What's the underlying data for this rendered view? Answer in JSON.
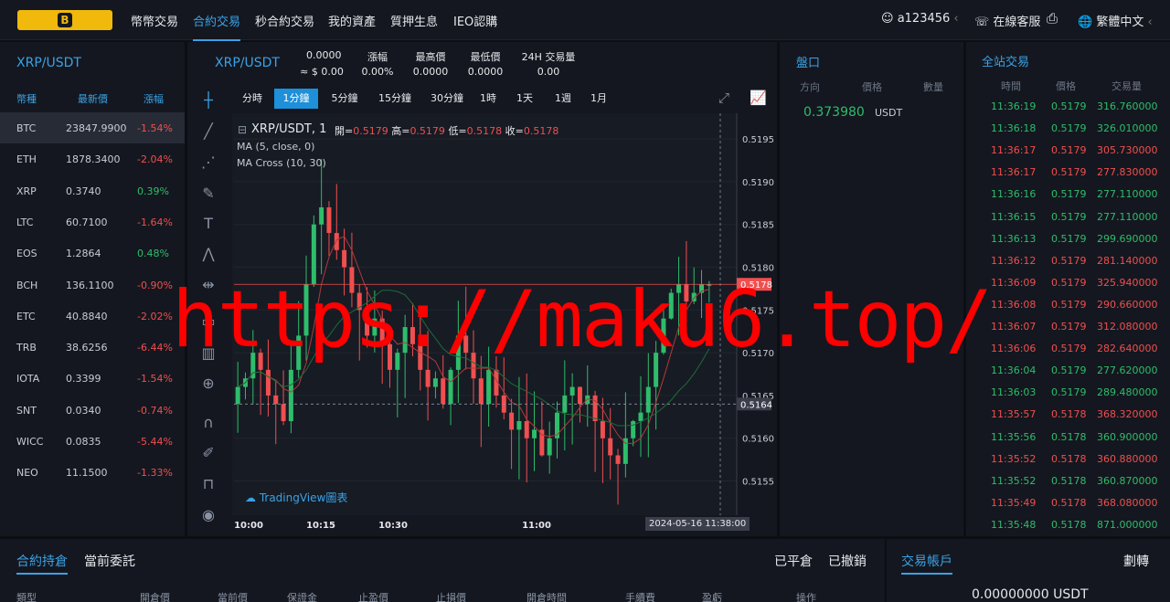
{
  "nav": {
    "logo_letter": "B",
    "links": [
      "幣幣交易",
      "合約交易",
      "秒合約交易",
      "我的資產",
      "質押生息",
      "IEO認購"
    ],
    "user": "a123456",
    "support": "在線客服",
    "lang": "繁體中文"
  },
  "market": {
    "title": "XRP/USDT",
    "headers": [
      "幣種",
      "最新價",
      "漲幅"
    ],
    "rows": [
      {
        "coin": "BTC",
        "price": "23847.9900",
        "change": "-1.54%",
        "up": false
      },
      {
        "coin": "ETH",
        "price": "1878.3400",
        "change": "-2.04%",
        "up": false
      },
      {
        "coin": "XRP",
        "price": "0.3740",
        "change": "0.39%",
        "up": true
      },
      {
        "coin": "LTC",
        "price": "60.7100",
        "change": "-1.64%",
        "up": false
      },
      {
        "coin": "EOS",
        "price": "1.2864",
        "change": "0.48%",
        "up": true
      },
      {
        "coin": "BCH",
        "price": "136.1100",
        "change": "-0.90%",
        "up": false
      },
      {
        "coin": "ETC",
        "price": "40.8840",
        "change": "-2.02%",
        "up": false
      },
      {
        "coin": "TRB",
        "price": "38.6256",
        "change": "-6.44%",
        "up": false
      },
      {
        "coin": "IOTA",
        "price": "0.3399",
        "change": "-1.54%",
        "up": false
      },
      {
        "coin": "SNT",
        "price": "0.0340",
        "change": "-0.74%",
        "up": false
      },
      {
        "coin": "WICC",
        "price": "0.0835",
        "change": "-5.44%",
        "up": false
      },
      {
        "coin": "NEO",
        "price": "11.1500",
        "change": "-1.33%",
        "up": false
      }
    ]
  },
  "ticker": {
    "pair": "XRP/USDT",
    "last": "0.0000",
    "approx": "≈ $ 0.00",
    "change_label": "漲幅",
    "change": "0.00%",
    "high_label": "最高價",
    "high": "0.0000",
    "low_label": "最低價",
    "low": "0.0000",
    "vol_label": "24H 交易量",
    "vol": "0.00"
  },
  "timeframes": [
    "分時",
    "1分鐘",
    "5分鐘",
    "15分鐘",
    "30分鐘",
    "1時",
    "1天",
    "1週",
    "1月"
  ],
  "chart": {
    "symbol": "XRP/USDT, 1",
    "ohlc_open_label": "開=",
    "ohlc_open": "0.5179",
    "ohlc_high_label": "高=",
    "ohlc_high": "0.5179",
    "ohlc_low_label": "低=",
    "ohlc_low": "0.5178",
    "ohlc_close_label": "收=",
    "ohlc_close": "0.5178",
    "ind1": "MA (5, close, 0)",
    "ind2": "MA Cross (10, 30)",
    "brand": "TradingView圖表",
    "price_ticks": [
      "0.5195",
      "0.5190",
      "0.5185",
      "0.5180",
      "0.5175",
      "0.5170",
      "0.5165",
      "0.5160",
      "0.5155"
    ],
    "last_price": "0.5178",
    "cross_price": "0.5164",
    "time_ticks": [
      "10:00",
      "10:15",
      "10:30",
      "11:00"
    ],
    "cursor_time": "2024-05-16 11:38:00"
  },
  "chart_data": {
    "type": "candlestick",
    "ylim": [
      0.5151,
      0.5198
    ],
    "last": 0.5178,
    "closes": [
      0.5166,
      0.5167,
      0.517,
      0.5168,
      0.5165,
      0.5164,
      0.5162,
      0.5168,
      0.5172,
      0.5178,
      0.5185,
      0.5187,
      0.5184,
      0.5182,
      0.518,
      0.5177,
      0.5175,
      0.5172,
      0.5174,
      0.5171,
      0.5168,
      0.517,
      0.5173,
      0.5171,
      0.5168,
      0.5166,
      0.5167,
      0.5164,
      0.5168,
      0.5172,
      0.517,
      0.5167,
      0.5164,
      0.5168,
      0.5165,
      0.5163,
      0.5161,
      0.5162,
      0.516,
      0.5161,
      0.5158,
      0.516,
      0.5163,
      0.5165,
      0.5166,
      0.5164,
      0.5165,
      0.5162,
      0.516,
      0.5158,
      0.5157,
      0.516,
      0.5162,
      0.5163,
      0.5166,
      0.517,
      0.5174,
      0.5177,
      0.5178,
      0.5176,
      0.5177,
      0.5178,
      0.5178
    ]
  },
  "orderbook": {
    "title": "盤口",
    "headers": [
      "方向",
      "價格",
      "數量"
    ],
    "price": "0.373980",
    "unit": "USDT"
  },
  "trades": {
    "title": "全站交易",
    "headers": [
      "時間",
      "價格",
      "交易量"
    ],
    "rows": [
      {
        "t": "11:36:19",
        "p": "0.5179",
        "v": "316.760000",
        "up": true
      },
      {
        "t": "11:36:18",
        "p": "0.5179",
        "v": "326.010000",
        "up": true
      },
      {
        "t": "11:36:17",
        "p": "0.5179",
        "v": "305.730000",
        "up": false
      },
      {
        "t": "11:36:17",
        "p": "0.5179",
        "v": "277.830000",
        "up": false
      },
      {
        "t": "11:36:16",
        "p": "0.5179",
        "v": "277.110000",
        "up": true
      },
      {
        "t": "11:36:15",
        "p": "0.5179",
        "v": "277.110000",
        "up": true
      },
      {
        "t": "11:36:13",
        "p": "0.5179",
        "v": "299.690000",
        "up": true
      },
      {
        "t": "11:36:12",
        "p": "0.5179",
        "v": "281.140000",
        "up": false
      },
      {
        "t": "11:36:09",
        "p": "0.5179",
        "v": "325.940000",
        "up": false
      },
      {
        "t": "11:36:08",
        "p": "0.5179",
        "v": "290.660000",
        "up": false
      },
      {
        "t": "11:36:07",
        "p": "0.5179",
        "v": "312.080000",
        "up": false
      },
      {
        "t": "11:36:06",
        "p": "0.5179",
        "v": "282.640000",
        "up": false
      },
      {
        "t": "11:36:04",
        "p": "0.5179",
        "v": "277.620000",
        "up": true
      },
      {
        "t": "11:36:03",
        "p": "0.5179",
        "v": "289.480000",
        "up": true
      },
      {
        "t": "11:35:57",
        "p": "0.5178",
        "v": "368.320000",
        "up": false
      },
      {
        "t": "11:35:56",
        "p": "0.5178",
        "v": "360.900000",
        "up": true
      },
      {
        "t": "11:35:52",
        "p": "0.5178",
        "v": "360.880000",
        "up": false
      },
      {
        "t": "11:35:52",
        "p": "0.5178",
        "v": "360.870000",
        "up": true
      },
      {
        "t": "11:35:49",
        "p": "0.5178",
        "v": "368.080000",
        "up": false
      },
      {
        "t": "11:35:48",
        "p": "0.5178",
        "v": "871.000000",
        "up": true
      }
    ]
  },
  "bottom": {
    "tab_positions": "合約持倉",
    "tab_orders": "當前委託",
    "closed": "已平倉",
    "cancelled": "已撤銷",
    "account": "交易帳戶",
    "transfer": "劃轉",
    "balance": "0.00000000 USDT",
    "cols": [
      "類型",
      "開倉價",
      "當前價",
      "保證金",
      "止盈價",
      "止損價",
      "開倉時間",
      "手續費",
      "盈虧",
      "操作"
    ]
  },
  "watermark": "https://maku6.top/"
}
